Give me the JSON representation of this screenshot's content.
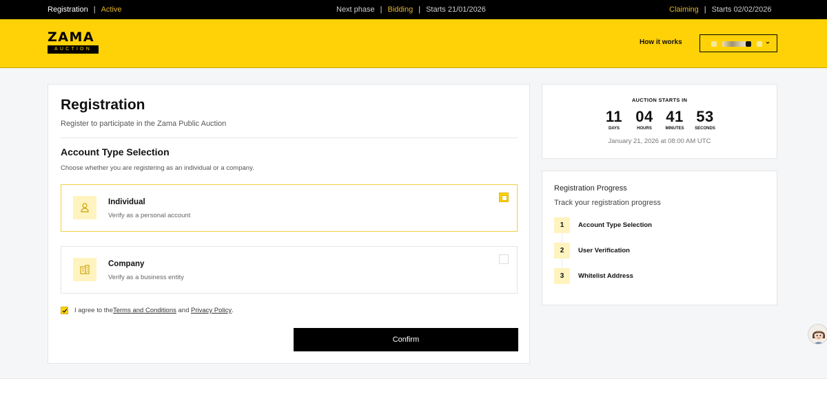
{
  "topbar": {
    "phase_label": "Registration",
    "phase_sep": "|",
    "phase_status": "Active",
    "next_label": "Next phase",
    "next_sep1": "|",
    "next_name": "Bidding",
    "next_sep2": "|",
    "next_start": "Starts 21/01/2026",
    "claim_name": "Claiming",
    "claim_sep": "|",
    "claim_start": "Starts 02/02/2026"
  },
  "header": {
    "logo_word": "ZAMA",
    "logo_sub": "AUCTION",
    "how_it_works": "How it works"
  },
  "registration": {
    "title": "Registration",
    "subtitle": "Register to participate in the Zama Public Auction",
    "section_title": "Account Type Selection",
    "section_subtitle": "Choose whether you are registering as an individual or a company.",
    "options": [
      {
        "title": "Individual",
        "description": "Verify as a personal account",
        "icon": "person-icon",
        "selected": true
      },
      {
        "title": "Company",
        "description": "Verify as a business entity",
        "icon": "building-icon",
        "selected": false
      }
    ],
    "agree_prefix": "I agree to the ",
    "terms_link": "Terms and Conditions",
    "agree_and": " and ",
    "privacy_link": "Privacy Policy",
    "agree_suffix": ".",
    "agree_checked": true,
    "confirm_label": "Confirm"
  },
  "countdown": {
    "label": "AUCTION STARTS IN",
    "units": [
      {
        "value": "11",
        "caption": "DAYS"
      },
      {
        "value": "04",
        "caption": "HOURS"
      },
      {
        "value": "41",
        "caption": "MINUTES"
      },
      {
        "value": "53",
        "caption": "SECONDS"
      }
    ],
    "date": "January 21, 2026 at 08:00 AM UTC"
  },
  "progress": {
    "title": "Registration Progress",
    "subtitle": "Track your registration progress",
    "steps": [
      {
        "number": "1",
        "label": "Account Type Selection"
      },
      {
        "number": "2",
        "label": "User Verification"
      },
      {
        "number": "3",
        "label": "Whitelist Address"
      }
    ]
  },
  "colors": {
    "brand_yellow": "#ffd208",
    "status_gold": "#e3b52a",
    "pale_yellow": "#fff3bf"
  }
}
